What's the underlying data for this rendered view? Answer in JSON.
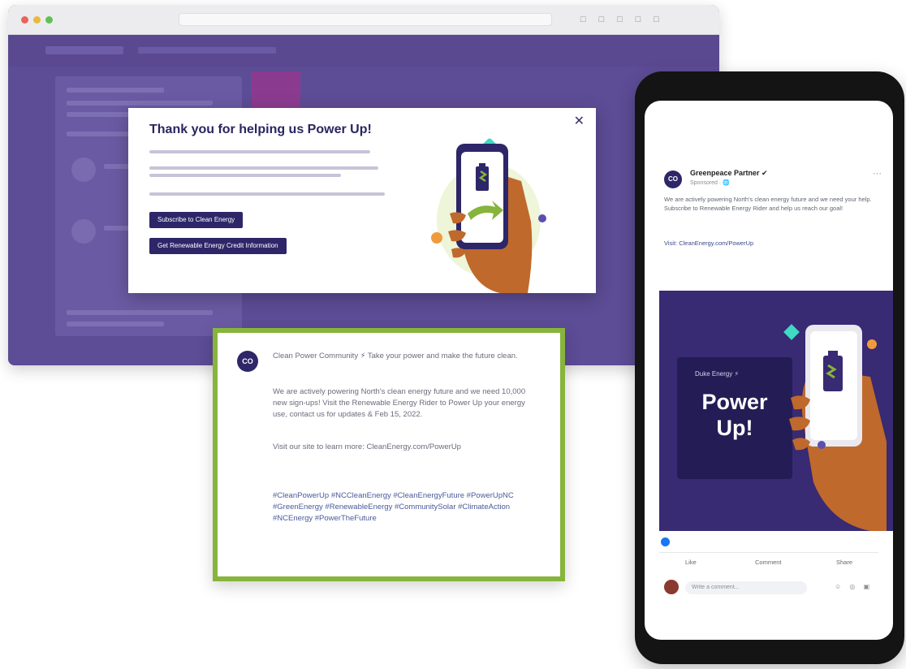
{
  "colors": {
    "brand_purple": "#2d2668",
    "site_purple": "#5b4a93",
    "accent_green": "#86b43c",
    "accent_orange": "#f09a3e",
    "accent_teal": "#3fd9c4"
  },
  "modal": {
    "title": "Thank you for helping us Power Up!",
    "close_icon": "close-icon",
    "button1": "Subscribe to Clean Energy",
    "button2": "Get Renewable Energy Credit Information"
  },
  "social_post": {
    "avatar_initials": "CO",
    "intro": "Clean Power Community ⚡ Take your power and make the future clean.",
    "body": "We are actively powering North's clean energy future and we need 10,000 new sign-ups! Visit the Renewable Energy Rider to Power Up your energy use, contact us for updates & Feb 15, 2022.",
    "cta": "Visit our site to learn more: CleanEnergy.com/PowerUp",
    "hashtags": "#CleanPowerUp #NCCleanEnergy #CleanEnergyFuture #PowerUpNC #GreenEnergy #RenewableEnergy #CommunitySolar #ClimateAction #NCEnergy #PowerTheFuture"
  },
  "facebook_post": {
    "page_name": "Greenpeace Partner ✔",
    "meta": "Sponsored · 🌐",
    "text": "We are actively powering North's clean energy future and we need your help. Subscribe to Renewable Energy Rider and help us reach our goal!",
    "link": "Visit: CleanEnergy.com/PowerUp",
    "promo": {
      "small": "Duke Energy ⚡",
      "big_line1": "Power",
      "big_line2": "Up!"
    },
    "like": "Like",
    "comment": "Comment",
    "share": "Share",
    "comment_placeholder": "Write a comment..."
  }
}
